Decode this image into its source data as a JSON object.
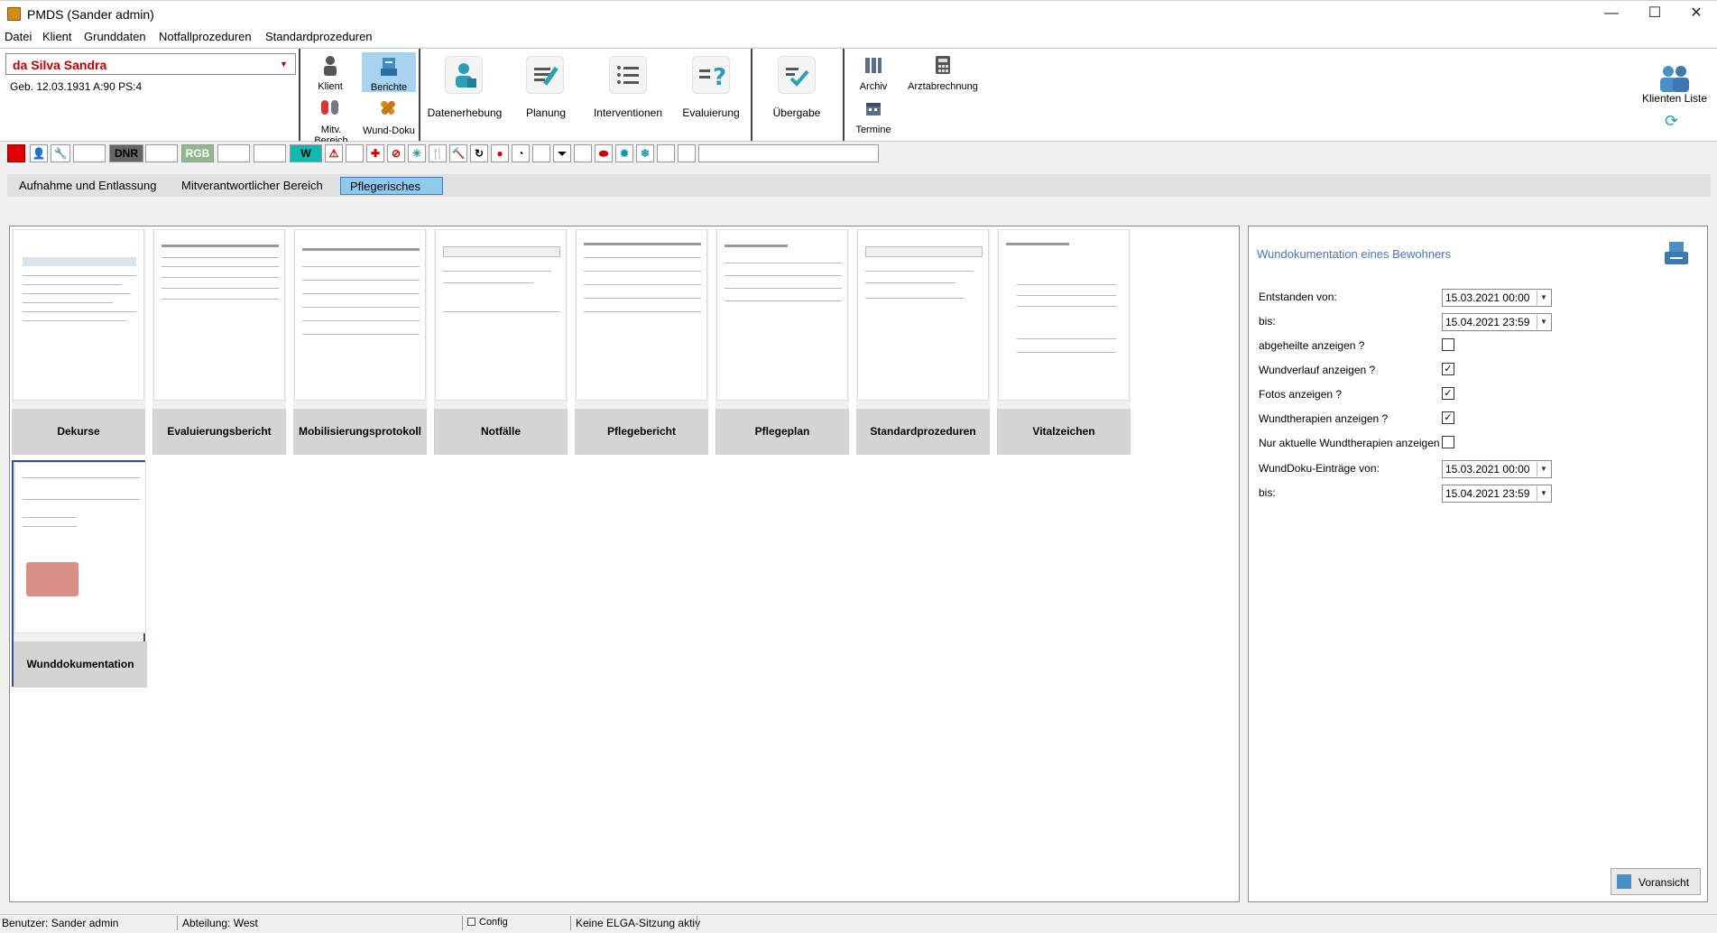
{
  "window": {
    "title": "PMDS (Sander admin)",
    "minimize": "—",
    "maximize": "☐",
    "close": "✕"
  },
  "menu": [
    "Datei",
    "Klient",
    "Grunddaten",
    "Notfallprozeduren",
    "Standardprozeduren"
  ],
  "client": {
    "name": "da Silva Sandra",
    "meta": "Geb. 12.03.1931   A:90   PS:4"
  },
  "ribbon": {
    "klient": "Klient",
    "berichte": "Berichte",
    "mitv_bereich": "Mitv. Bereich",
    "wund_doku": "Wund-Doku",
    "datenerhebung": "Datenerhebung",
    "planung": "Planung",
    "interventionen": "Interventionen",
    "evaluierung": "Evaluierung",
    "uebergabe": "Übergabe",
    "archiv": "Archiv",
    "arztabrechnung": "Arztabrechnung",
    "termine": "Termine",
    "klienten_liste": "Klienten Liste"
  },
  "strip": {
    "dnr": "DNR",
    "rgb": "RGB",
    "w": "W"
  },
  "tabs": [
    "Aufnahme und Entlassung",
    "Mitverantwortlicher Bereich",
    "Pflegerisches"
  ],
  "reports": [
    "Dekurse",
    "Evaluierungsbericht",
    "Mobilisierungsprotokoll",
    "Notfälle",
    "Pflegebericht",
    "Pflegeplan",
    "Standardprozeduren",
    "Vitalzeichen",
    "Wunddokumentation"
  ],
  "right": {
    "title": "Wundokumentation eines Bewohners",
    "entstanden_label": "Entstanden von:",
    "entstanden_value": "15.03.2021 00:00",
    "bis1_label": "bis:",
    "bis1_value": "15.04.2021 23:59",
    "abgeheilte": "abgeheilte anzeigen ?",
    "wundverlauf": "Wundverlauf anzeigen ?",
    "fotos": "Fotos anzeigen ?",
    "wundtherapien": "Wundtherapien anzeigen ?",
    "nur_aktuelle": "Nur aktuelle Wundtherapien anzeigen ?",
    "wunddoku_label": "WundDoku-Einträge von:",
    "wunddoku_value": "15.03.2021 00:00",
    "bis2_label": "bis:",
    "bis2_value": "15.04.2021 23:59",
    "voransicht": "Voransicht",
    "checks": {
      "abgeheilte": false,
      "wundverlauf": true,
      "fotos": true,
      "wundtherapien": true,
      "nur_aktuelle": false
    }
  },
  "status": {
    "benutzer": "Benutzer: Sander admin",
    "abteilung": "Abteilung: West",
    "config": "Config",
    "elga": "Keine ELGA-Sitzung aktiv"
  },
  "colors": {
    "accent": "#4a90c8",
    "client_name": "#c00000",
    "active_tab": "#8fc9ee"
  }
}
